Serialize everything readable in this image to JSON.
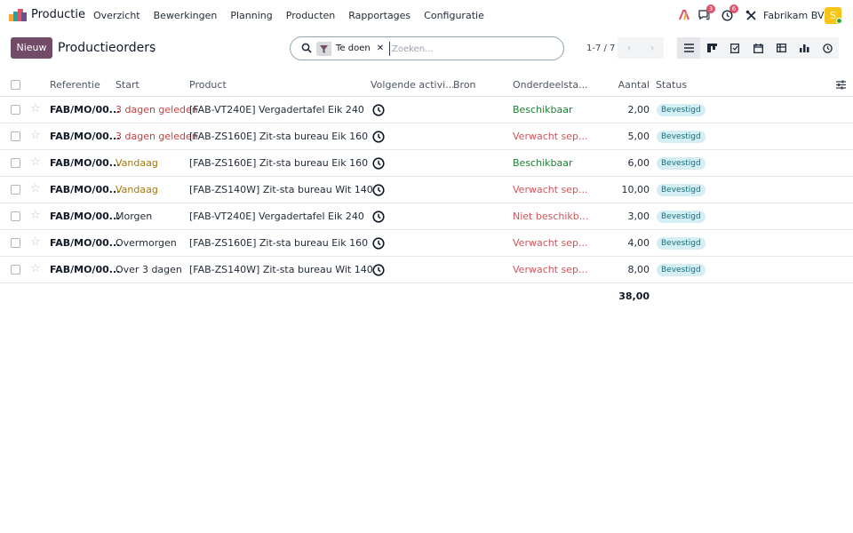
{
  "app": {
    "name": "Productie",
    "menu": [
      "Overzicht",
      "Bewerkingen",
      "Planning",
      "Producten",
      "Rapportages",
      "Configuratie"
    ],
    "messages_count": "3",
    "activities_count": "6",
    "company": "Fabrikam BV",
    "avatar_letter": "S"
  },
  "control": {
    "new_label": "Nieuw",
    "title": "Productieorders",
    "search_facet": "Te doen",
    "search_placeholder": "Zoeken...",
    "pager": "1-7 / 7"
  },
  "table": {
    "headers": {
      "reference": "Referentie",
      "start": "Start",
      "product": "Product",
      "activity": "Volgende activi...",
      "source": "Bron",
      "component": "Onderdeelsta...",
      "quantity": "Aantal",
      "status": "Status"
    },
    "rows": [
      {
        "reference": "FAB/MO/00...",
        "start": "3 dagen geleden",
        "start_style": "red",
        "product": "[FAB-VT240E] Vergadertafel Eik 240",
        "component": "Beschikbaar",
        "component_style": "green",
        "quantity": "2,00",
        "status": "Bevestigd"
      },
      {
        "reference": "FAB/MO/00...",
        "start": "3 dagen geleden",
        "start_style": "red",
        "product": "[FAB-ZS160E] Zit-sta bureau Eik 160",
        "component": "Verwacht sep...",
        "component_style": "warn",
        "quantity": "5,00",
        "status": "Bevestigd"
      },
      {
        "reference": "FAB/MO/00...",
        "start": "Vandaag",
        "start_style": "orange",
        "product": "[FAB-ZS160E] Zit-sta bureau Eik 160",
        "component": "Beschikbaar",
        "component_style": "green",
        "quantity": "6,00",
        "status": "Bevestigd"
      },
      {
        "reference": "FAB/MO/00...",
        "start": "Vandaag",
        "start_style": "orange",
        "product": "[FAB-ZS140W] Zit-sta bureau Wit 140",
        "component": "Verwacht sep...",
        "component_style": "warn",
        "quantity": "10,00",
        "status": "Bevestigd"
      },
      {
        "reference": "FAB/MO/00...",
        "start": "Morgen",
        "start_style": "plain",
        "product": "[FAB-VT240E] Vergadertafel Eik 240",
        "component": "Niet beschikb...",
        "component_style": "warn",
        "quantity": "3,00",
        "status": "Bevestigd"
      },
      {
        "reference": "FAB/MO/00...",
        "start": "Overmorgen",
        "start_style": "plain",
        "product": "[FAB-ZS160E] Zit-sta bureau Eik 160",
        "component": "Verwacht sep...",
        "component_style": "warn",
        "quantity": "4,00",
        "status": "Bevestigd"
      },
      {
        "reference": "FAB/MO/00...",
        "start": "Over 3 dagen",
        "start_style": "plain",
        "product": "[FAB-ZS140W] Zit-sta bureau Wit 140",
        "component": "Verwacht sep...",
        "component_style": "warn",
        "quantity": "8,00",
        "status": "Bevestigd"
      }
    ],
    "total_quantity": "38,00"
  }
}
